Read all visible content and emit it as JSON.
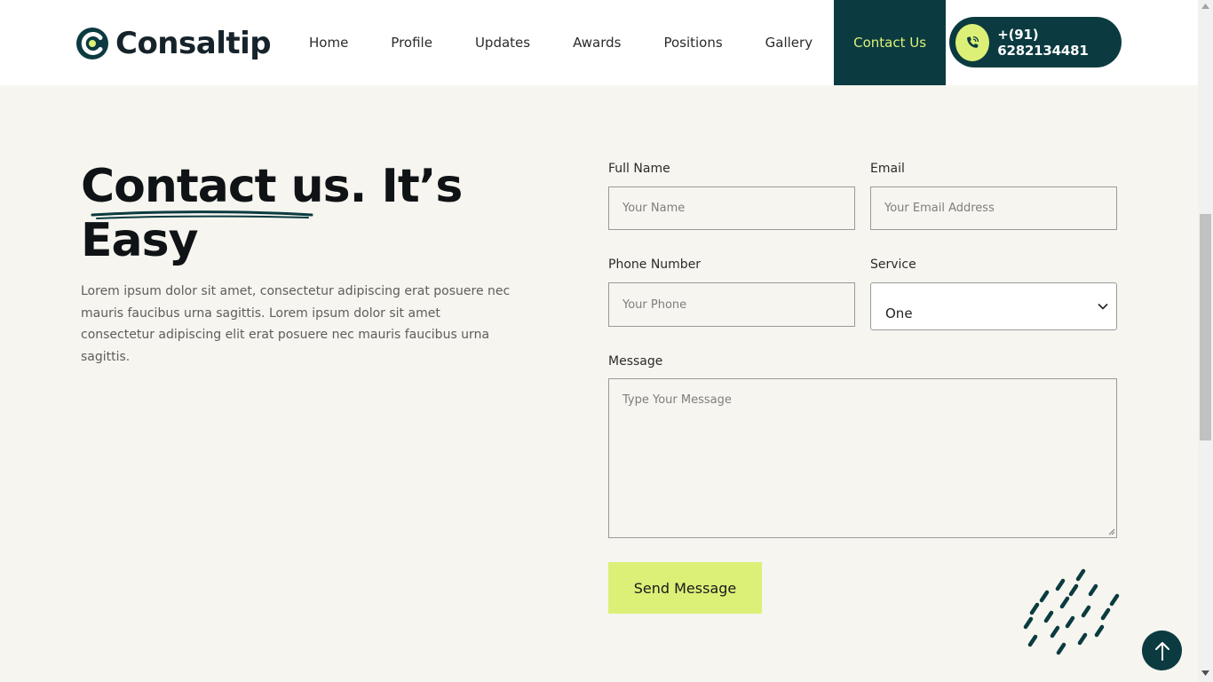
{
  "brand": {
    "name": "Consaltip"
  },
  "nav": {
    "items": [
      {
        "label": "Home",
        "active": false
      },
      {
        "label": "Profile",
        "active": false
      },
      {
        "label": "Updates",
        "active": false
      },
      {
        "label": "Awards",
        "active": false
      },
      {
        "label": "Positions",
        "active": false
      },
      {
        "label": "Gallery",
        "active": false
      },
      {
        "label": "Contact Us",
        "active": true
      }
    ],
    "phone": "+(91) 6282134481",
    "phone_icon": "phone-call-icon"
  },
  "hero": {
    "title_line1": "Contact us. It’s",
    "title_line2": "Easy",
    "description": "Lorem ipsum dolor sit amet, consectetur adipiscing erat posuere nec mauris faucibus urna sagittis. Lorem ipsum dolor sit amet consectetur adipiscing elit erat posuere nec mauris faucibus urna sagittis."
  },
  "form": {
    "full_name": {
      "label": "Full Name",
      "placeholder": "Your Name",
      "value": ""
    },
    "email": {
      "label": "Email",
      "placeholder": "Your Email Address",
      "value": ""
    },
    "phone": {
      "label": "Phone Number",
      "placeholder": "Your Phone",
      "value": ""
    },
    "service": {
      "label": "Service",
      "selected": "One"
    },
    "message": {
      "label": "Message",
      "placeholder": "Type Your Message",
      "value": ""
    },
    "submit_label": "Send Message"
  },
  "colors": {
    "brand_dark": "#0b3b40",
    "accent": "#dcf078",
    "page_bg": "#f6f5ef"
  },
  "scroll_top_icon": "arrow-up-icon"
}
